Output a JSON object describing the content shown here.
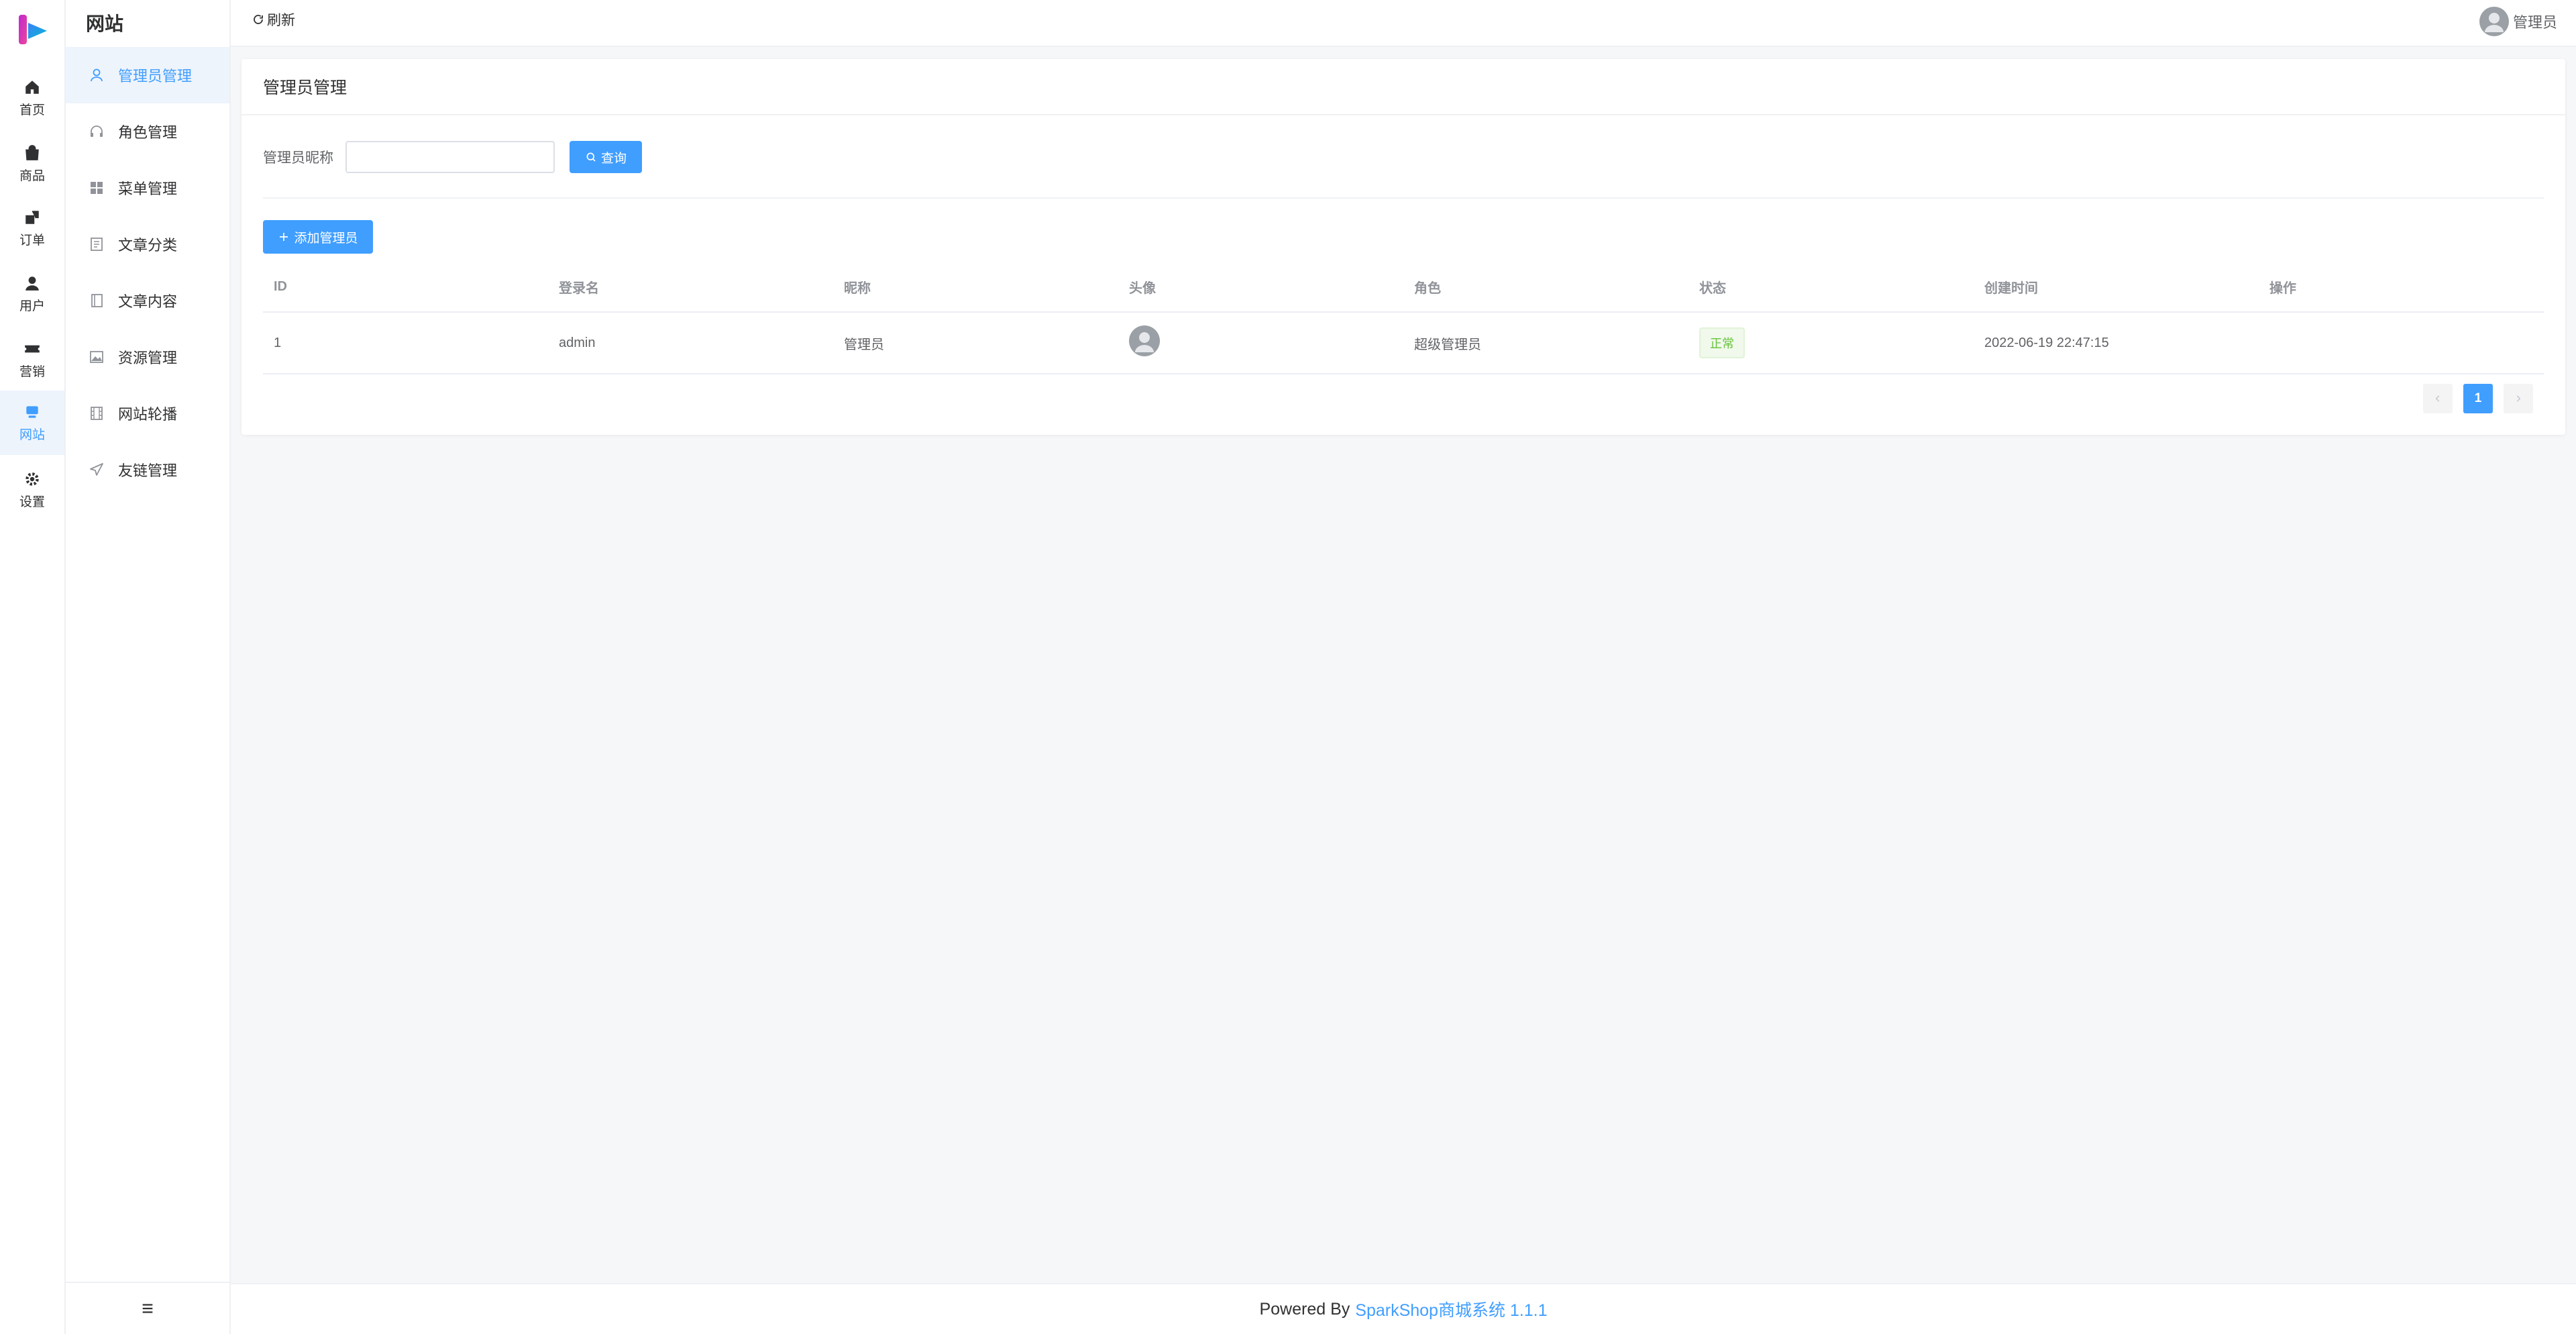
{
  "rail": {
    "items": [
      {
        "label": "首页",
        "icon": "home-icon"
      },
      {
        "label": "商品",
        "icon": "bag-icon"
      },
      {
        "label": "订单",
        "icon": "order-icon"
      },
      {
        "label": "用户",
        "icon": "user-icon"
      },
      {
        "label": "营销",
        "icon": "ticket-icon"
      },
      {
        "label": "网站",
        "icon": "monitor-icon",
        "active": true
      },
      {
        "label": "设置",
        "icon": "gear-icon"
      }
    ]
  },
  "sidebar": {
    "title": "网站",
    "items": [
      {
        "label": "管理员管理",
        "icon": "user-outline-icon",
        "active": true
      },
      {
        "label": "角色管理",
        "icon": "headset-icon"
      },
      {
        "label": "菜单管理",
        "icon": "grid-icon"
      },
      {
        "label": "文章分类",
        "icon": "list-doc-icon"
      },
      {
        "label": "文章内容",
        "icon": "notebook-icon"
      },
      {
        "label": "资源管理",
        "icon": "picture-icon"
      },
      {
        "label": "网站轮播",
        "icon": "film-icon"
      },
      {
        "label": "友链管理",
        "icon": "send-icon"
      }
    ]
  },
  "topbar": {
    "refresh_label": "刷新",
    "user_name": "管理员"
  },
  "card": {
    "title": "管理员管理",
    "search": {
      "label": "管理员昵称",
      "value": "",
      "placeholder": "",
      "button_label": "查询"
    },
    "add_button_label": "添加管理员",
    "table": {
      "headers": [
        "ID",
        "登录名",
        "昵称",
        "头像",
        "角色",
        "状态",
        "创建时间",
        "操作"
      ],
      "rows": [
        {
          "id": "1",
          "login": "admin",
          "nickname": "管理员",
          "role": "超级管理员",
          "status": "正常",
          "created": "2022-06-19 22:47:15",
          "actions": ""
        }
      ]
    },
    "pagination": {
      "current": "1"
    }
  },
  "footer": {
    "prefix": "Powered By",
    "link": "SparkShop商城系统 1.1.1"
  },
  "colors": {
    "primary": "#409eff",
    "success": "#67c23a",
    "background": "#f6f7f9"
  }
}
